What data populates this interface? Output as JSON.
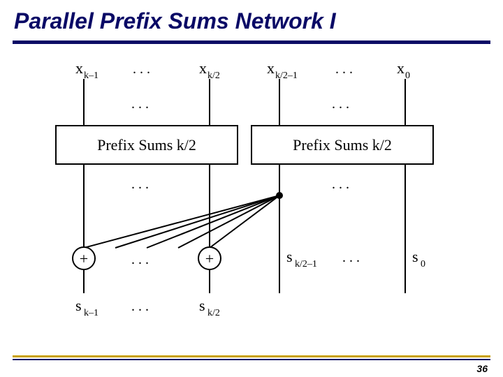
{
  "title": "Parallel Prefix Sums Network I",
  "page_number": "36",
  "diagram": {
    "inputs": {
      "leftA": {
        "var": "x",
        "sub": "k–1"
      },
      "leftB": {
        "var": "x",
        "sub": "k/2"
      },
      "rightA": {
        "var": "x",
        "sub": "k/2–1"
      },
      "rightB": {
        "var": "x",
        "sub": "0"
      }
    },
    "block_left": "Prefix Sums k/2",
    "block_right": "Prefix Sums k/2",
    "outputs": {
      "leftA": {
        "var": "s",
        "sub": "k–1"
      },
      "leftB": {
        "var": "s",
        "sub": "k/2"
      },
      "rightA": {
        "var": "s",
        "sub": "k/2–1"
      },
      "rightB": {
        "var": "s",
        "sub": "0"
      }
    },
    "adder_symbol": "+",
    "input_dots": ". . .",
    "mid_dots": ". . .",
    "low_dots": ". . .",
    "cdots": ". . ."
  }
}
